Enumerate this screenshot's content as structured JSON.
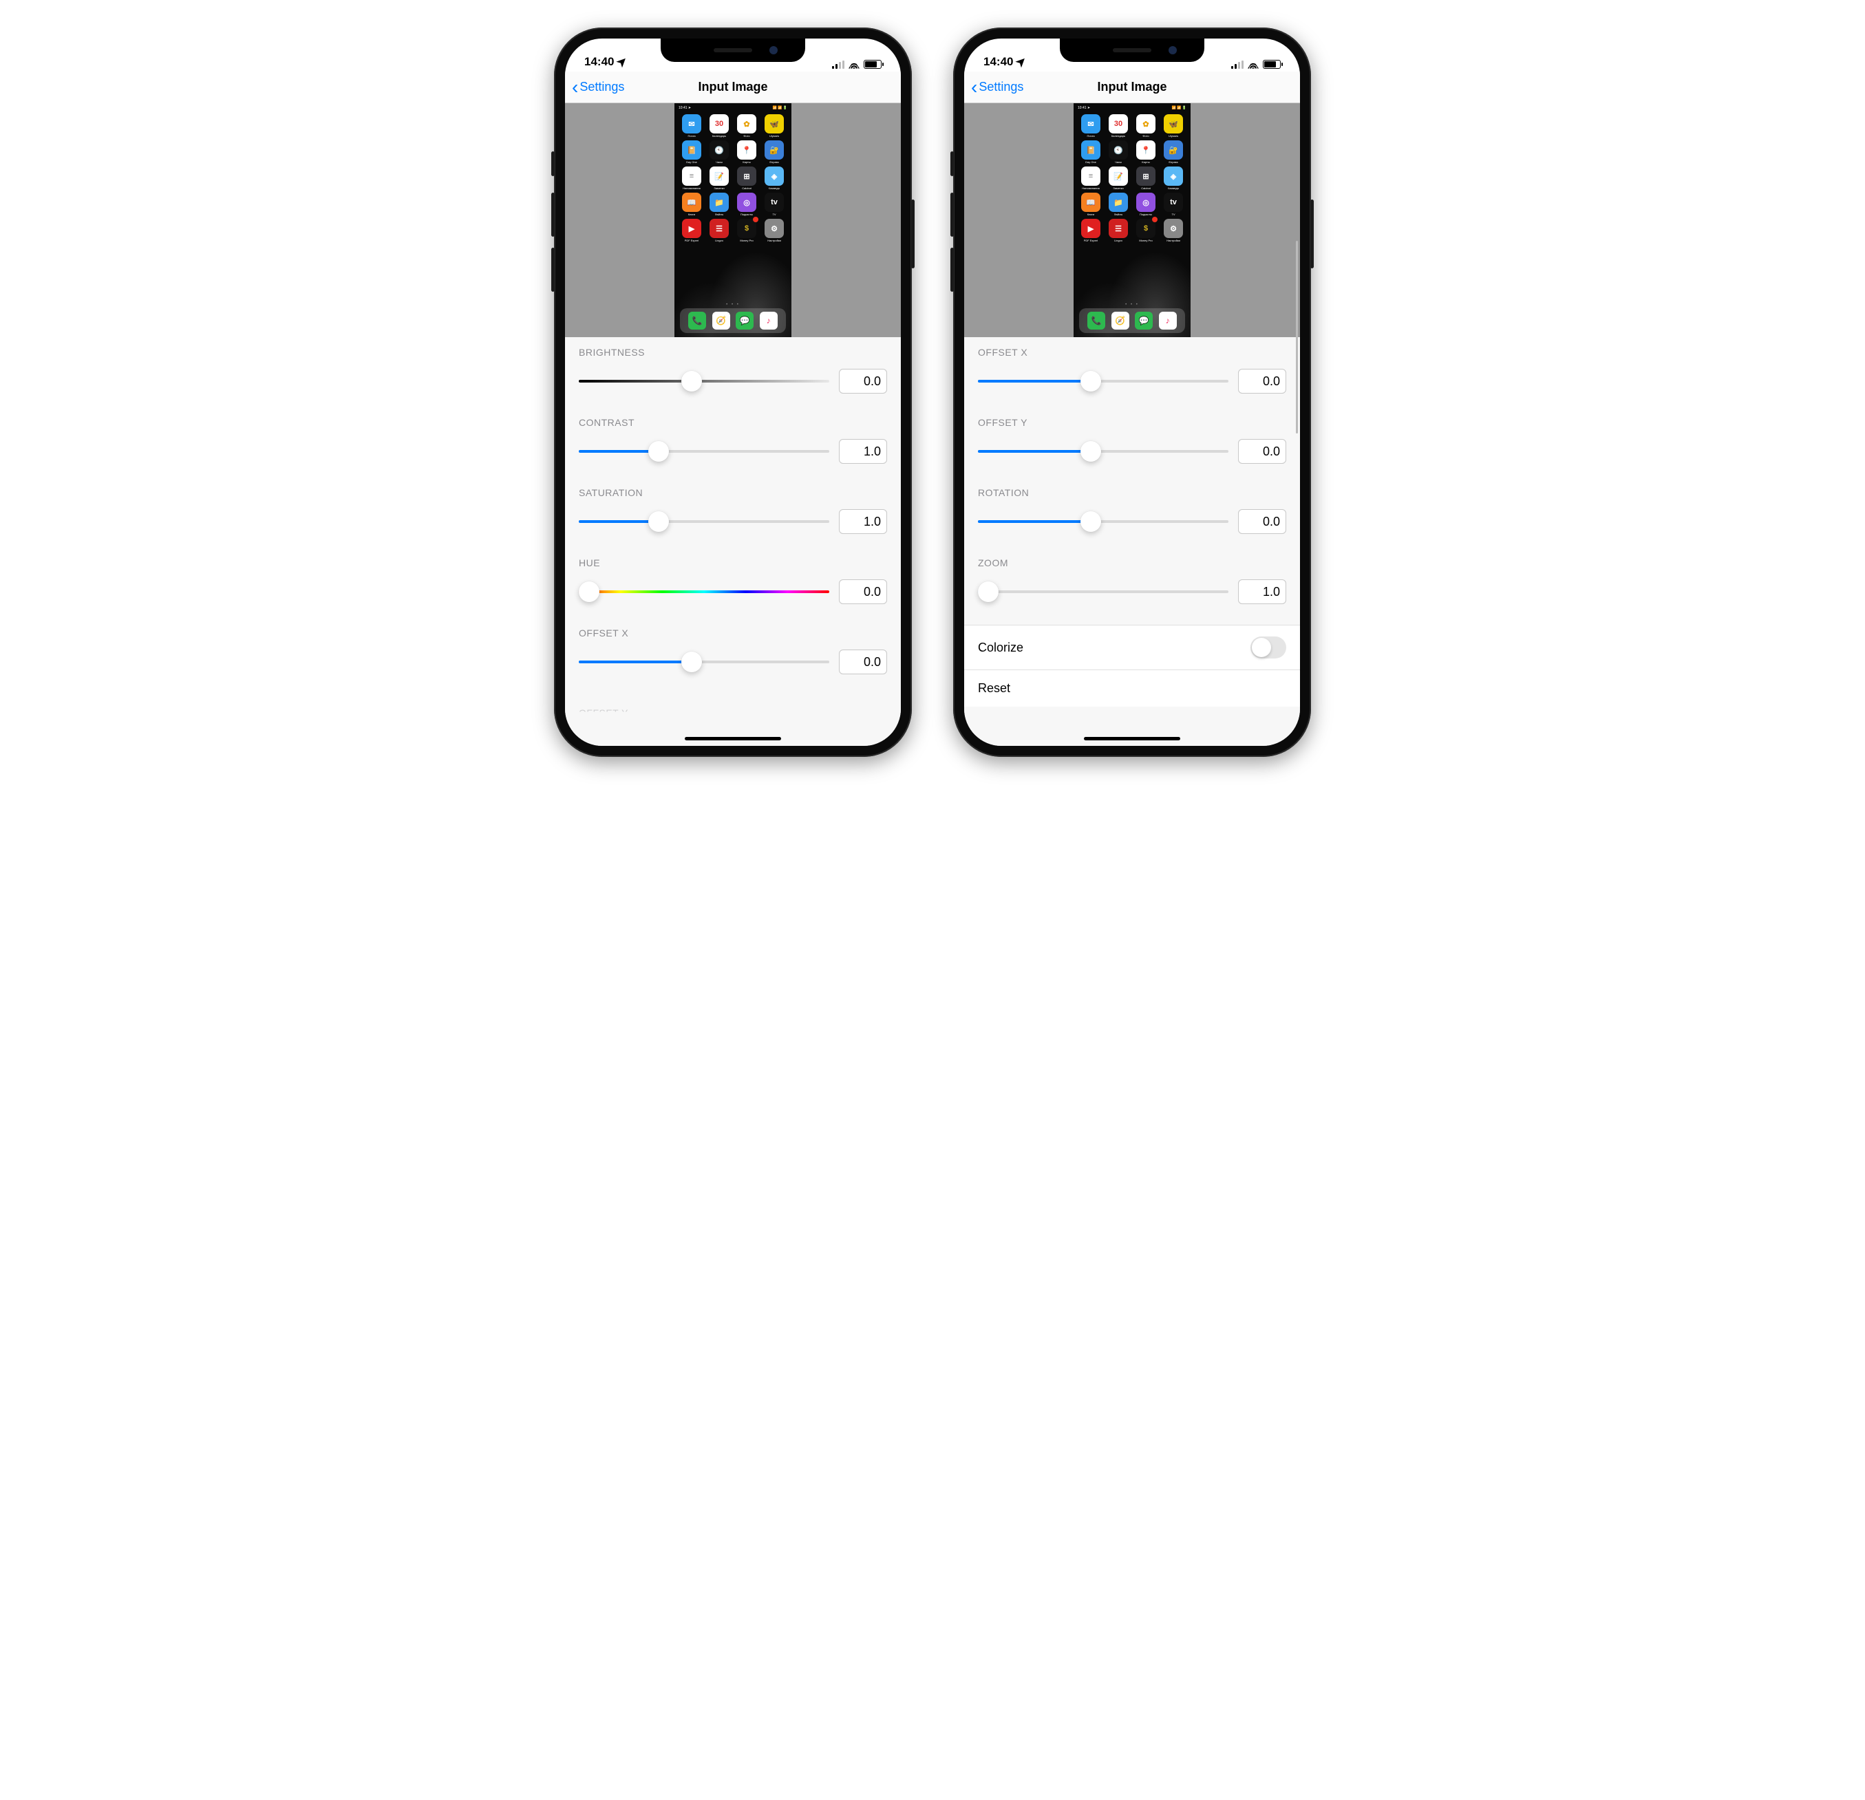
{
  "status": {
    "time": "14:40",
    "location_icon": "➤"
  },
  "nav": {
    "back": "Settings",
    "title": "Input Image"
  },
  "preview": {
    "mini_time": "10:41 ➤",
    "apps": [
      {
        "name": "Почта",
        "bg": "#2f9df0",
        "sym": "✉"
      },
      {
        "name": "Календарь",
        "bg": "#fff",
        "sym": "30",
        "fg": "#e03030"
      },
      {
        "name": "Фото",
        "bg": "#fff",
        "sym": "✿",
        "fg": "#e8a000"
      },
      {
        "name": "Ulysses",
        "bg": "#f0d000",
        "sym": "🦋",
        "fg": "#333"
      },
      {
        "name": "Day One",
        "bg": "#2f9df0",
        "sym": "📔"
      },
      {
        "name": "Часы",
        "bg": "#111",
        "sym": "🕙"
      },
      {
        "name": "Карты",
        "bg": "#fff",
        "sym": "📍",
        "fg": "#3080e8"
      },
      {
        "name": "Enpass",
        "bg": "#3b7fd8",
        "sym": "🔐"
      },
      {
        "name": "Напоминания",
        "bg": "#fff",
        "sym": "≡",
        "fg": "#888"
      },
      {
        "name": "Заметки",
        "bg": "#fff",
        "sym": "📝",
        "fg": "#e0a020"
      },
      {
        "name": "Calcbot",
        "bg": "#3a3a40",
        "sym": "⊞"
      },
      {
        "name": "Команды",
        "bg": "#5ab8f5",
        "sym": "◈"
      },
      {
        "name": "Книги",
        "bg": "#f58020",
        "sym": "📖"
      },
      {
        "name": "Файлы",
        "bg": "#3595ea",
        "sym": "📁"
      },
      {
        "name": "Подкасты",
        "bg": "#9050e0",
        "sym": "◎"
      },
      {
        "name": "TV",
        "bg": "#111",
        "sym": "tv",
        "txt": "tv"
      },
      {
        "name": "PDF Expert",
        "bg": "#e02020",
        "sym": "▶"
      },
      {
        "name": "Lingvo",
        "bg": "#d02020",
        "sym": "☰"
      },
      {
        "name": "Money Pro",
        "bg": "#111",
        "sym": "$",
        "fg": "#d0b020",
        "badge": true
      },
      {
        "name": "Настройки",
        "bg": "#888",
        "sym": "⚙"
      }
    ],
    "dock": [
      {
        "bg": "#2db94f",
        "sym": "📞"
      },
      {
        "bg": "#fff",
        "sym": "🧭",
        "fg": "#3080e8"
      },
      {
        "bg": "#2db94f",
        "sym": "💬"
      },
      {
        "bg": "#fff",
        "sym": "♪",
        "fg": "#f03060"
      }
    ]
  },
  "left_sliders": [
    {
      "key": "brightness",
      "label": "BRIGHTNESS",
      "value": "0.0",
      "pos": 45,
      "style": "bw"
    },
    {
      "key": "contrast",
      "label": "CONTRAST",
      "value": "1.0",
      "pos": 32,
      "style": "blue"
    },
    {
      "key": "saturation",
      "label": "SATURATION",
      "value": "1.0",
      "pos": 32,
      "style": "blue"
    },
    {
      "key": "hue",
      "label": "HUE",
      "value": "0.0",
      "pos": 4,
      "style": "hue"
    },
    {
      "key": "offsetx",
      "label": "OFFSET X",
      "value": "0.0",
      "pos": 45,
      "style": "blue"
    }
  ],
  "left_cutoff_label": "OFFSET Y",
  "right_sliders": [
    {
      "key": "offsetx",
      "label": "OFFSET X",
      "value": "0.0",
      "pos": 45,
      "style": "blue"
    },
    {
      "key": "offsety",
      "label": "OFFSET Y",
      "value": "0.0",
      "pos": 45,
      "style": "blue"
    },
    {
      "key": "rotation",
      "label": "ROTATION",
      "value": "0.0",
      "pos": 45,
      "style": "blue"
    },
    {
      "key": "zoom",
      "label": "ZOOM",
      "value": "1.0",
      "pos": 4,
      "style": "blue"
    }
  ],
  "right_rows": {
    "colorize": "Colorize",
    "reset": "Reset"
  }
}
